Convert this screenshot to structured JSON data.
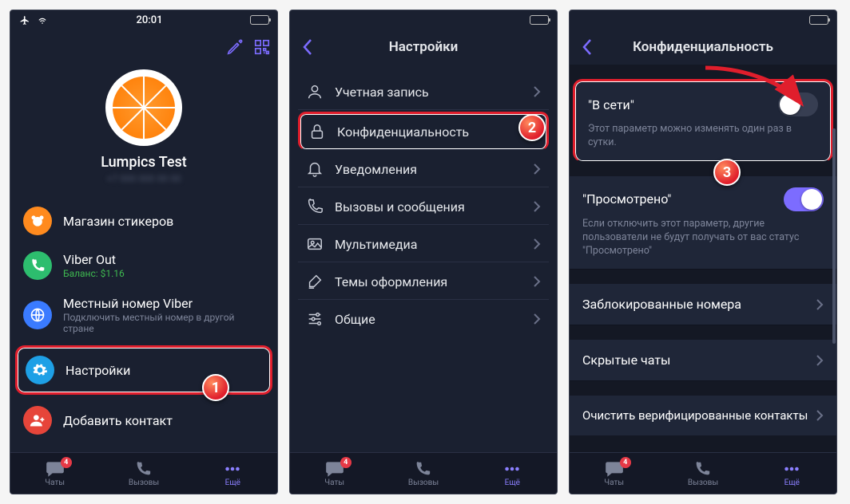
{
  "status": {
    "time": "20:01"
  },
  "screen1": {
    "profile_name": "Lumpics Test",
    "menu": {
      "stickers": "Магазин стикеров",
      "viberout_title": "Viber Out",
      "viberout_balance": "Баланс: $1.16",
      "localnum_title": "Местный номер Viber",
      "localnum_sub": "Подключить местный номер в другой стране",
      "settings": "Настройки",
      "addcontact": "Добавить контакт"
    }
  },
  "screen2": {
    "title": "Настройки",
    "items": {
      "account": "Учетная запись",
      "privacy": "Конфиденциальность",
      "notifications": "Уведомления",
      "calls": "Вызовы и сообщения",
      "media": "Мультимедиа",
      "themes": "Темы оформления",
      "general": "Общие"
    }
  },
  "screen3": {
    "title": "Конфиденциальность",
    "online": {
      "title": "\"В сети\"",
      "desc": "Этот параметр можно изменять один раз в сутки."
    },
    "seen": {
      "title": "\"Просмотрено\"",
      "desc": "Если отключить этот параметр, другие пользователи не будут получать от вас статус \"Просмотрено\""
    },
    "blocked": "Заблокированные номера",
    "hidden": "Скрытые чаты",
    "clear": "Очистить верифицированные контакты"
  },
  "nav": {
    "chats": "Чаты",
    "calls": "Вызовы",
    "more": "Ещё",
    "badge": "4"
  },
  "steps": {
    "s1": "1",
    "s2": "2",
    "s3": "3"
  }
}
